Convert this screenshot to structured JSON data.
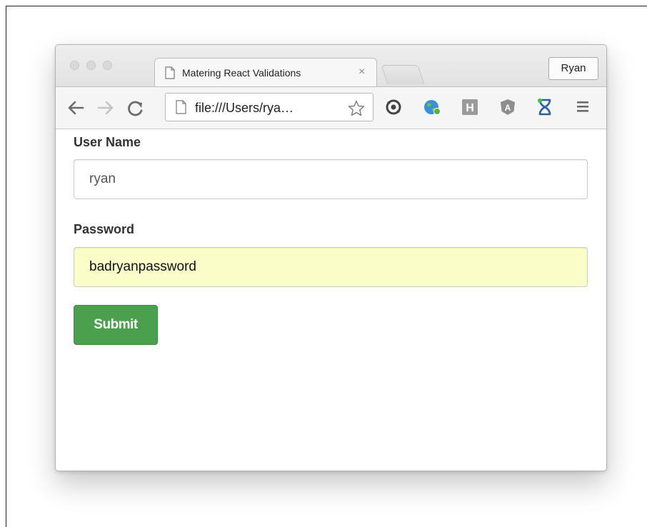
{
  "browser": {
    "tab_title": "Matering React Validations",
    "tab_close_glyph": "×",
    "profile_name": "Ryan",
    "url": "file:///Users/rya…",
    "icons": [
      "back-arrow-icon",
      "forward-arrow-icon",
      "reload-icon",
      "document-icon",
      "star-icon",
      "sync-extension-icon",
      "globe-extension-icon",
      "h-extension-icon",
      "angular-extension-icon",
      "hourglass-extension-icon",
      "menu-icon"
    ]
  },
  "form": {
    "username_label": "User Name",
    "username_value": "ryan",
    "password_label": "Password",
    "password_value": "badryanpassword",
    "submit_label": "Submit"
  },
  "colors": {
    "submit": "#4aa04d",
    "autofill": "#fbfdc8"
  }
}
